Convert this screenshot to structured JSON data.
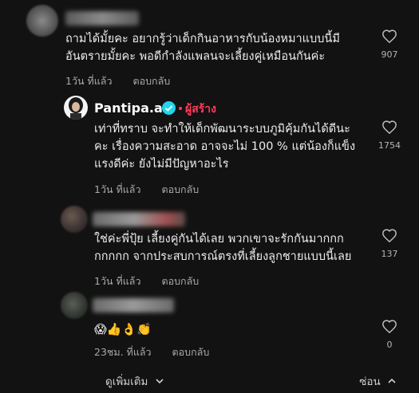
{
  "comments": [
    {
      "text": "ถามได้มั้ยคะ อยากรู้ว่าเด็กกินอาหารกับน้องหมาแบบนี้มี\nอันตรายมั้ยคะ พอดีกำลังแพลนจะเลี้ยงคู่เหมือนกันค่ะ",
      "time": "1วัน ที่แล้ว",
      "reply": "ตอบกลับ",
      "likes": "907"
    },
    {
      "username": "Pantipa.a",
      "creator_label": "ผู้สร้าง",
      "text": "เท่าที่ทราบ จะทำให้เด็กพัฒนาระบบภูมิคุ้มกันได้ดีนะ\nคะ เรื่องความสะอาด อาจจะไม่ 100 % แต่น้องก็แข็ง\nแรงดีค่ะ ยังไม่มีปัญหาอะไร",
      "time": "1วัน ที่แล้ว",
      "reply": "ตอบกลับ",
      "likes": "1754"
    },
    {
      "text": "ใช่ค่ะพี่ปุ้ย เลี้ยงคู่กันได้เลย พวกเขาจะรักกันมากกก\nกกกกก จากประสบการณ์ตรงที่เลี้ยงลูกชายแบบนี้เลย",
      "time": "1วัน ที่แล้ว",
      "reply": "ตอบกลับ",
      "likes": "137"
    },
    {
      "text": "😱👍👌👏",
      "time": "23ชม. ที่แล้ว",
      "reply": "ตอบกลับ",
      "likes": "0"
    }
  ],
  "footer": {
    "see_more": "ดูเพิ่มเติม",
    "hide": "ซ่อน"
  },
  "colors": {
    "background": "#121212",
    "creator": "#ff3b5c",
    "verified": "#20d5ec"
  }
}
